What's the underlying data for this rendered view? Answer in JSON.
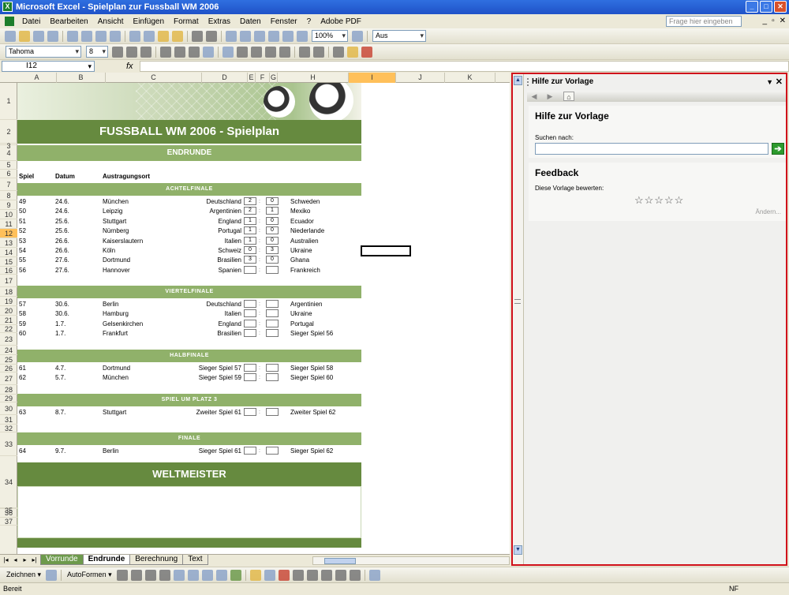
{
  "window": {
    "title": "Microsoft Excel - Spielplan zur Fussball WM 2006"
  },
  "menu": {
    "items": [
      "Datei",
      "Bearbeiten",
      "Ansicht",
      "Einfügen",
      "Format",
      "Extras",
      "Daten",
      "Fenster",
      "?",
      "Adobe PDF"
    ],
    "help_placeholder": "Frage hier eingeben"
  },
  "toolbar": {
    "zoom": "100%",
    "style": "Aus"
  },
  "format_toolbar": {
    "font": "Tahoma",
    "size": "8"
  },
  "formula_bar": {
    "name_box": "I12",
    "fx": "fx",
    "value": ""
  },
  "columns": [
    "A",
    "B",
    "C",
    "D",
    "E",
    "F",
    "G",
    "H",
    "I",
    "J",
    "K"
  ],
  "selected_column": "I",
  "rows": [
    "1",
    "2",
    "3",
    "4",
    "5",
    "6",
    "7",
    "8",
    "9",
    "10",
    "11",
    "12",
    "13",
    "14",
    "15",
    "16",
    "17",
    "18",
    "19",
    "20",
    "21",
    "22",
    "23",
    "24",
    "25",
    "26",
    "27",
    "28",
    "29",
    "30",
    "31",
    "32",
    "33",
    "34",
    "35",
    "36",
    "37"
  ],
  "selected_row": "12",
  "sheet": {
    "title": "FUSSBALL WM 2006 - Spielplan",
    "round": "ENDRUNDE",
    "headers": {
      "spiel": "Spiel",
      "datum": "Datum",
      "ort": "Austragungsort"
    },
    "sections": [
      {
        "name": "ACHTELFINALE",
        "matches": [
          {
            "spiel": "49",
            "datum": "24.6.",
            "ort": "München",
            "home": "Deutschland",
            "s1": "2",
            "s2": "0",
            "away": "Schweden"
          },
          {
            "spiel": "50",
            "datum": "24.6.",
            "ort": "Leipzig",
            "home": "Argentinien",
            "s1": "2",
            "s2": "1",
            "away": "Mexiko"
          },
          {
            "spiel": "51",
            "datum": "25.6.",
            "ort": "Stuttgart",
            "home": "England",
            "s1": "1",
            "s2": "0",
            "away": "Ecuador"
          },
          {
            "spiel": "52",
            "datum": "25.6.",
            "ort": "Nürnberg",
            "home": "Portugal",
            "s1": "1",
            "s2": "0",
            "away": "Niederlande"
          },
          {
            "spiel": "53",
            "datum": "26.6.",
            "ort": "Kaiserslautern",
            "home": "Italien",
            "s1": "1",
            "s2": "0",
            "away": "Australien"
          },
          {
            "spiel": "54",
            "datum": "26.6.",
            "ort": "Köln",
            "home": "Schweiz",
            "s1": "0",
            "s2": "3",
            "away": "Ukraine"
          },
          {
            "spiel": "55",
            "datum": "27.6.",
            "ort": "Dortmund",
            "home": "Brasilien",
            "s1": "3",
            "s2": "0",
            "away": "Ghana"
          },
          {
            "spiel": "56",
            "datum": "27.6.",
            "ort": "Hannover",
            "home": "Spanien",
            "s1": "",
            "s2": "",
            "away": "Frankreich"
          }
        ]
      },
      {
        "name": "VIERTELFINALE",
        "matches": [
          {
            "spiel": "57",
            "datum": "30.6.",
            "ort": "Berlin",
            "home": "Deutschland",
            "s1": "",
            "s2": "",
            "away": "Argentinien"
          },
          {
            "spiel": "58",
            "datum": "30.6.",
            "ort": "Hamburg",
            "home": "Italien",
            "s1": "",
            "s2": "",
            "away": "Ukraine"
          },
          {
            "spiel": "59",
            "datum": "1.7.",
            "ort": "Gelsenkirchen",
            "home": "England",
            "s1": "",
            "s2": "",
            "away": "Portugal"
          },
          {
            "spiel": "60",
            "datum": "1.7.",
            "ort": "Frankfurt",
            "home": "Brasilien",
            "s1": "",
            "s2": "",
            "away": "Sieger Spiel 56"
          }
        ]
      },
      {
        "name": "HALBFINALE",
        "matches": [
          {
            "spiel": "61",
            "datum": "4.7.",
            "ort": "Dortmund",
            "home": "Sieger Spiel 57",
            "s1": "",
            "s2": "",
            "away": "Sieger Spiel 58"
          },
          {
            "spiel": "62",
            "datum": "5.7.",
            "ort": "München",
            "home": "Sieger Spiel 59",
            "s1": "",
            "s2": "",
            "away": "Sieger Spiel 60"
          }
        ]
      },
      {
        "name": "SPIEL UM PLATZ 3",
        "matches": [
          {
            "spiel": "63",
            "datum": "8.7.",
            "ort": "Stuttgart",
            "home": "Zweiter Spiel 61",
            "s1": "",
            "s2": "",
            "away": "Zweiter Spiel 62"
          }
        ]
      },
      {
        "name": "FINALE",
        "matches": [
          {
            "spiel": "64",
            "datum": "9.7.",
            "ort": "Berlin",
            "home": "Sieger Spiel 61",
            "s1": "",
            "s2": "",
            "away": "Sieger Spiel 62"
          }
        ]
      }
    ],
    "weltmeister": "WELTMEISTER"
  },
  "sheet_tabs": [
    "Vorrunde",
    "Endrunde",
    "Berechnung",
    "Text"
  ],
  "active_tab": "Endrunde",
  "task_pane": {
    "title": "Hilfe zur Vorlage",
    "heading": "Hilfe zur Vorlage",
    "search_label": "Suchen nach:",
    "search_value": "",
    "feedback_heading": "Feedback",
    "rate_label": "Diese Vorlage bewerten:",
    "stars": "☆☆☆☆☆",
    "change_link": "Ändern..."
  },
  "drawing_toolbar": {
    "draw_label": "Zeichnen ▾",
    "autoshapes_label": "AutoFormen ▾"
  },
  "status": {
    "left": "Bereit",
    "right": "NF"
  },
  "colors": {
    "dark_green": "#668a3f",
    "light_green": "#90b16a",
    "pane_border": "#d0101a"
  }
}
